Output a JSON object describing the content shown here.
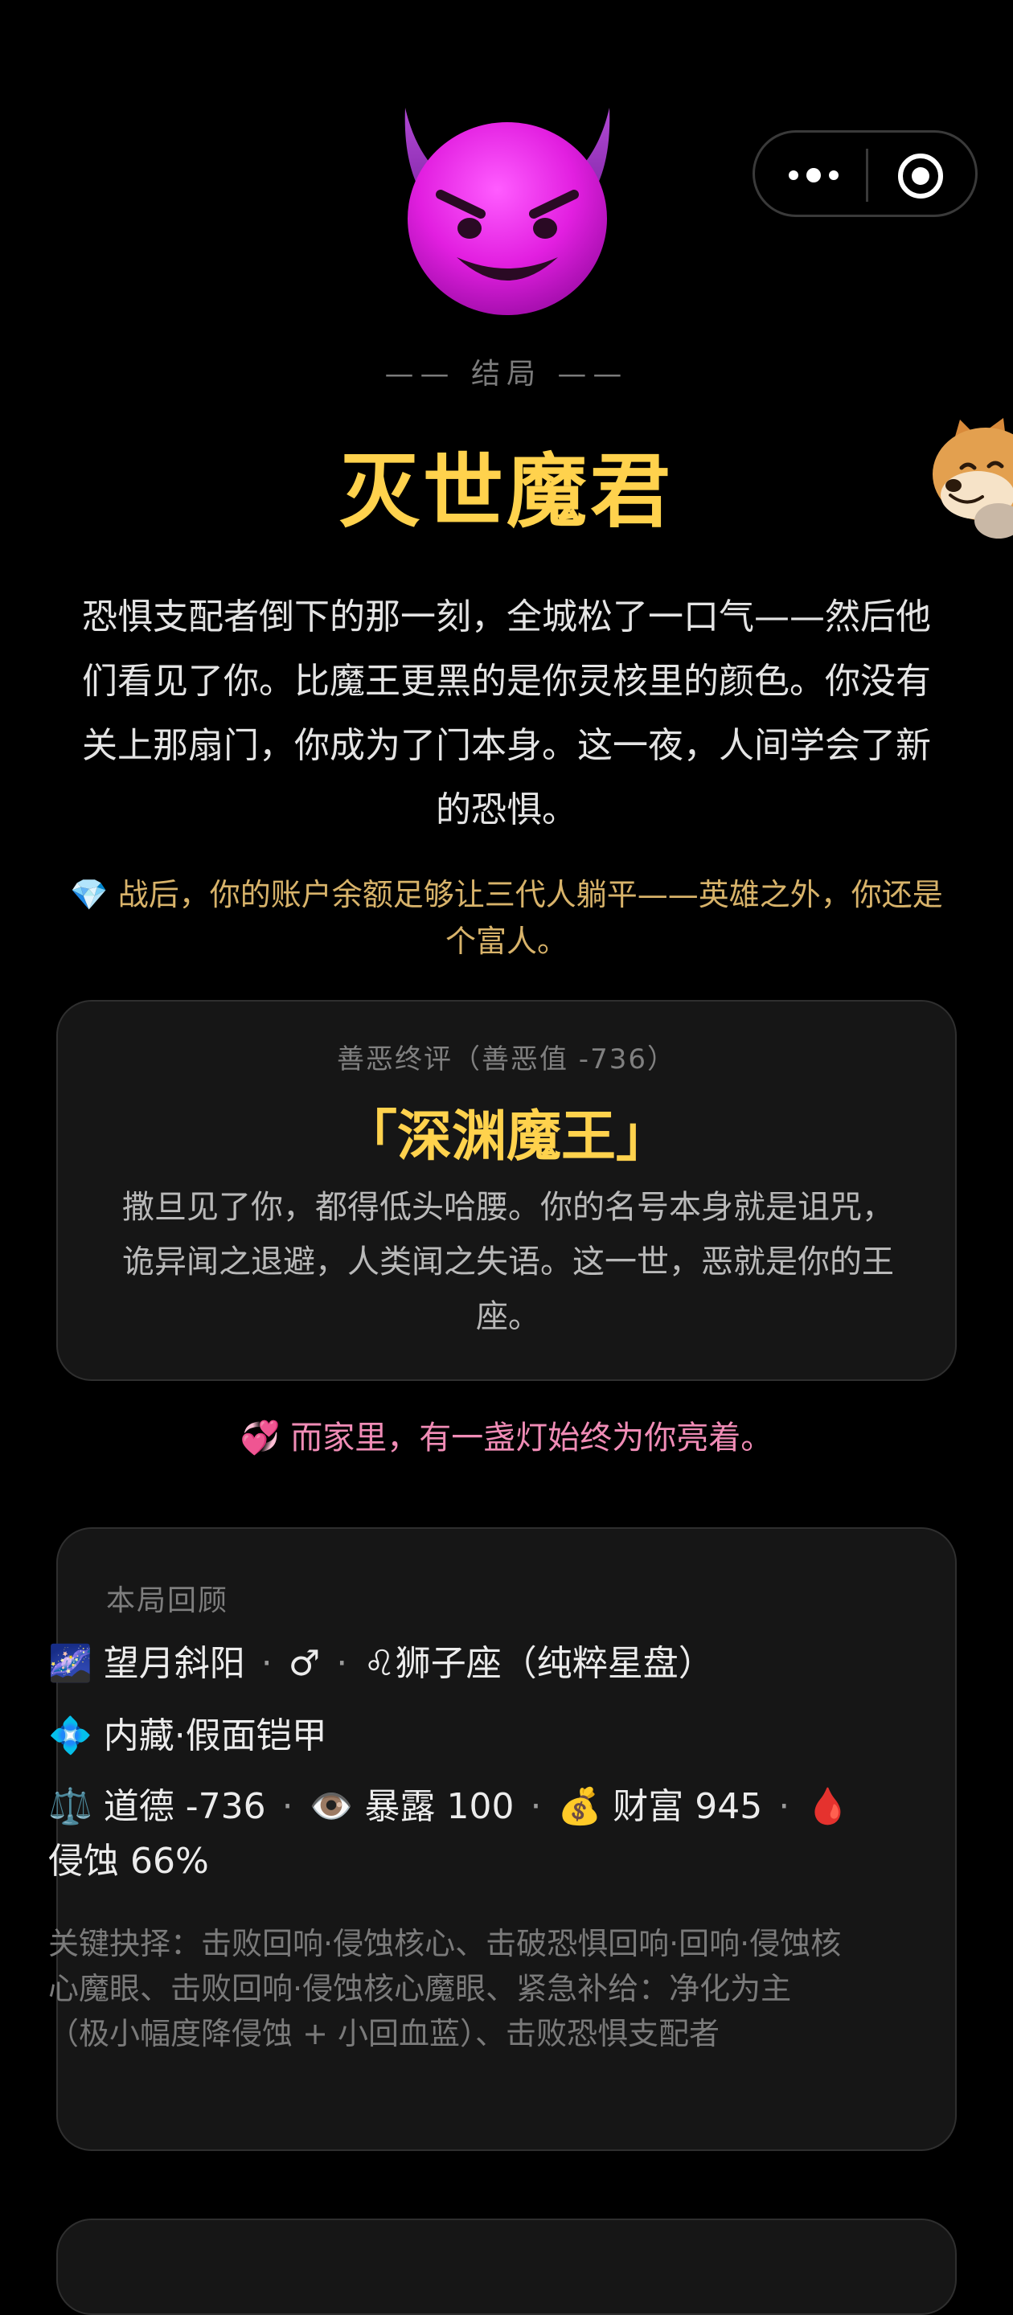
{
  "header": {
    "ending_kicker": "—— 结局 ——",
    "ending_title": "灭世魔君",
    "ending_description": "恐惧支配者倒下的那一刻，全城松了一口气——然后他们看见了你。比魔王更黑的是你灵核里的颜色。你没有关上那扇门，你成为了门本身。这一夜，人间学会了新的恐惧。",
    "wealth_note": "💎 战后，你的账户余额足够让三代人躺平——英雄之外，你还是个富人。"
  },
  "icons": {
    "hero": "smiling-face-with-horns-icon",
    "menu": "more-dots-icon",
    "close": "target-circle-icon",
    "mascot": "shiba-dog-icon"
  },
  "verdict": {
    "label": "善恶终评（善恶值 -736）",
    "title": "「深渊魔王」",
    "description": "撒旦见了你，都得低头哈腰。你的名号本身就是诅咒，诡异闻之退避，人类闻之失语。这一世，恶就是你的王座。"
  },
  "family_note": "💞 而家里，有一盏灯始终为你亮着。",
  "review": {
    "heading": "本局回顾",
    "origin": {
      "emoji": "🌌",
      "name": "望月斜阳",
      "gender": "♂",
      "zodiac_emoji": "♌",
      "zodiac": "狮子座（纯粹星盘）"
    },
    "trait": {
      "emoji": "💠",
      "text": "内藏·假面铠甲"
    },
    "stats": {
      "morality_emoji": "⚖️",
      "morality_label": "道德",
      "morality_value": "-736",
      "exposure_emoji": "👁️",
      "exposure_label": "暴露",
      "exposure_value": "100",
      "wealth_emoji": "💰",
      "wealth_label": "财富",
      "wealth_value": "945",
      "corrosion_emoji": "🩸",
      "corrosion_label": "侵蚀",
      "corrosion_value": "66%"
    },
    "key_choices": "关键抉择：击败回响·侵蚀核心、击破恐惧回响·回响·侵蚀核心魔眼、击败回响·侵蚀核心魔眼、紧急补给：净化为主（极小幅度降侵蚀 + 小回血蓝）、击败恐惧支配者"
  },
  "colors": {
    "background": "#000000",
    "title_gold": "#ffd24d",
    "card_bg": "#161616",
    "wealth_text": "#d8b36a",
    "family_text": "#f08cb6"
  }
}
